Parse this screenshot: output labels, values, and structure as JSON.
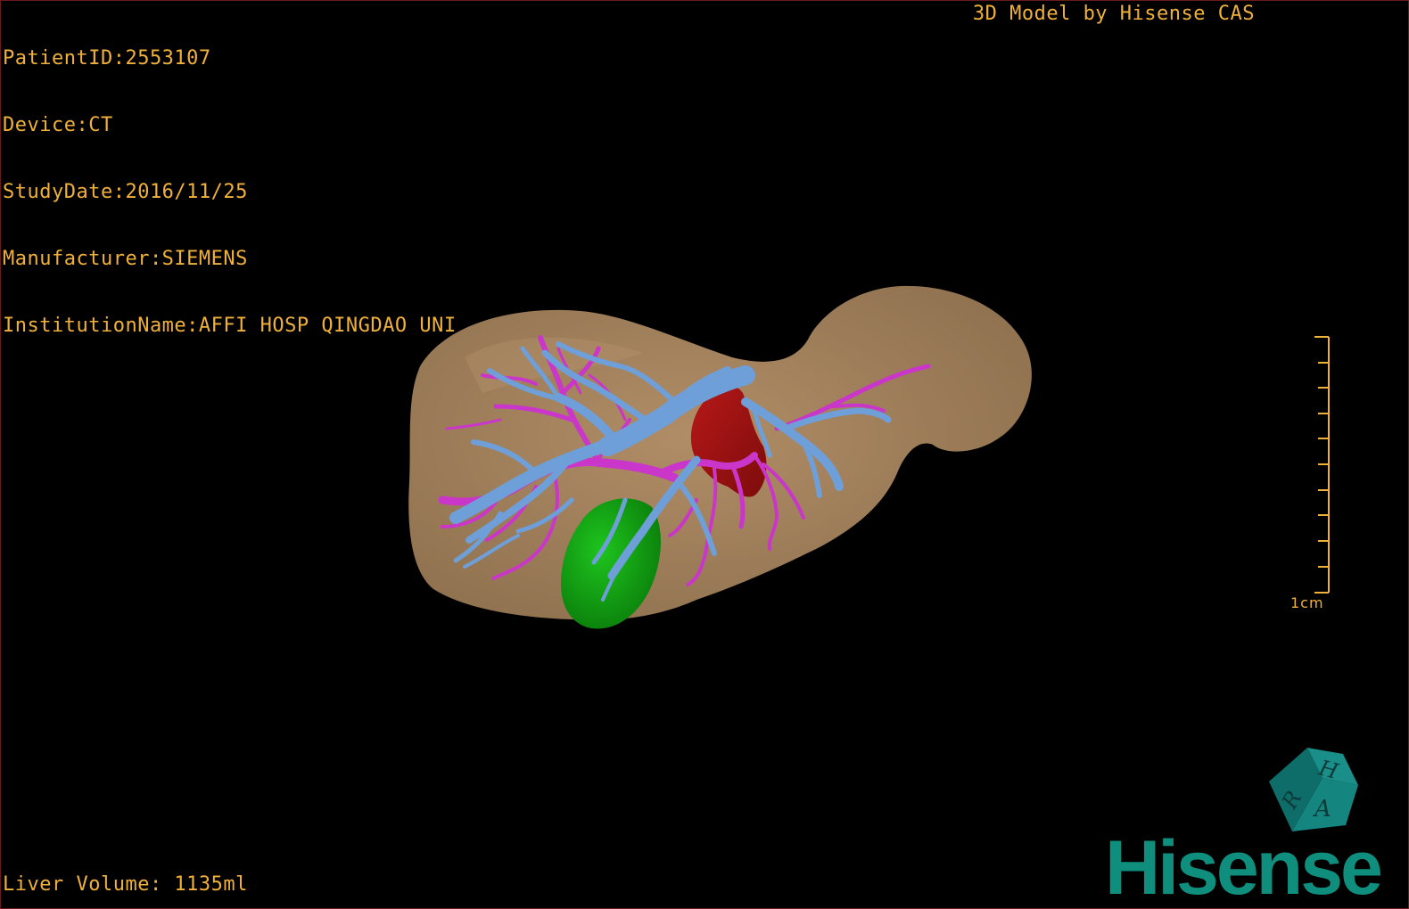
{
  "overlay": {
    "patient_id": "PatientID:2553107",
    "device": "Device:CT",
    "study_date": "StudyDate:2016/11/25",
    "manufacturer": "Manufacturer:SIEMENS",
    "institution": "InstitutionName:AFFI HOSP QINGDAO UNI",
    "credit": "3D Model by Hisense CAS",
    "liver_volume": "Liver Volume: 1135ml",
    "scale_label": "1cm"
  },
  "orientation_cube": {
    "face_top": "H",
    "face_left": "R",
    "face_right": "A",
    "color": "#137b77"
  },
  "brand": {
    "name": "Hisense",
    "color": "#0f8e7e"
  },
  "colors": {
    "text": "#f0b13a",
    "liver": "#a6845f",
    "portal_vein": "#6e9fd9",
    "hepatic_artery": "#c936c9",
    "vena_cava": "#9c1010",
    "gallbladder": "#11a311",
    "border": "#6b1a1a"
  }
}
